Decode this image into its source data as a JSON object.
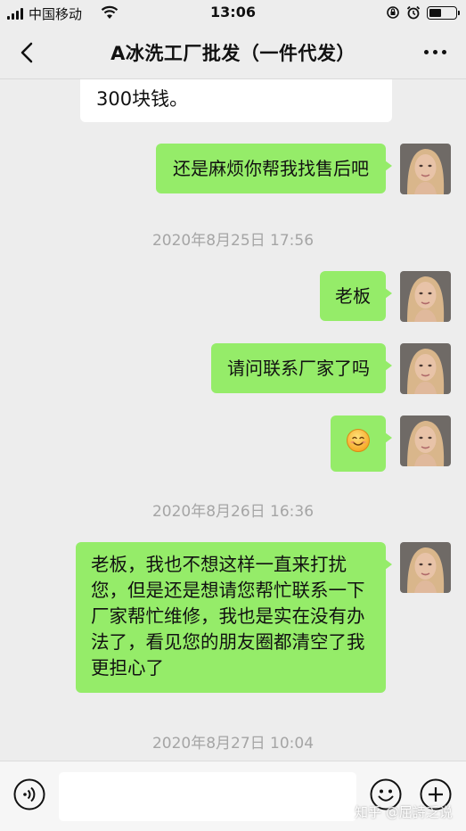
{
  "status_bar": {
    "carrier": "中国移动",
    "time": "13:06",
    "battery_level": 0.45
  },
  "nav": {
    "title": "A冰洗工厂批发（一件代发）",
    "back_icon": "chevron-left-icon",
    "more_icon": "ellipsis-icon"
  },
  "messages": {
    "m0": "300块钱。",
    "m1": "还是麻烦你帮我找售后吧",
    "ts1": "2020年8月25日 17:56",
    "m2": "老板",
    "m3": "请问联系厂家了吗",
    "m4_emoji": "smile-emoji",
    "ts2": "2020年8月26日 16:36",
    "m5": "老板，我也不想这样一直来打扰您，但是还是想请您帮忙联系一下厂家帮忙维修，我也是实在没有办法了，看见您的朋友圈都清空了我更担心了",
    "ts3": "2020年8月27日 10:04"
  },
  "input_bar": {
    "voice_icon": "voice-icon",
    "emoji_icon": "emoji-icon",
    "plus_icon": "plus-icon",
    "watermark": "知乎 @屈詩乏说"
  },
  "colors": {
    "background": "#ededed",
    "bubble_green": "#95ec69",
    "bubble_white": "#ffffff",
    "timestamp": "#a5a5a5"
  }
}
